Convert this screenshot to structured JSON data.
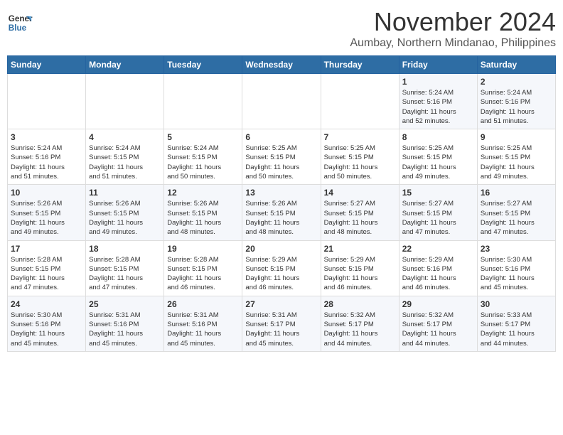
{
  "logo": {
    "line1": "General",
    "line2": "Blue"
  },
  "title": "November 2024",
  "location": "Aumbay, Northern Mindanao, Philippines",
  "weekdays": [
    "Sunday",
    "Monday",
    "Tuesday",
    "Wednesday",
    "Thursday",
    "Friday",
    "Saturday"
  ],
  "weeks": [
    [
      {
        "day": "",
        "info": ""
      },
      {
        "day": "",
        "info": ""
      },
      {
        "day": "",
        "info": ""
      },
      {
        "day": "",
        "info": ""
      },
      {
        "day": "",
        "info": ""
      },
      {
        "day": "1",
        "info": "Sunrise: 5:24 AM\nSunset: 5:16 PM\nDaylight: 11 hours\nand 52 minutes."
      },
      {
        "day": "2",
        "info": "Sunrise: 5:24 AM\nSunset: 5:16 PM\nDaylight: 11 hours\nand 51 minutes."
      }
    ],
    [
      {
        "day": "3",
        "info": "Sunrise: 5:24 AM\nSunset: 5:16 PM\nDaylight: 11 hours\nand 51 minutes."
      },
      {
        "day": "4",
        "info": "Sunrise: 5:24 AM\nSunset: 5:15 PM\nDaylight: 11 hours\nand 51 minutes."
      },
      {
        "day": "5",
        "info": "Sunrise: 5:24 AM\nSunset: 5:15 PM\nDaylight: 11 hours\nand 50 minutes."
      },
      {
        "day": "6",
        "info": "Sunrise: 5:25 AM\nSunset: 5:15 PM\nDaylight: 11 hours\nand 50 minutes."
      },
      {
        "day": "7",
        "info": "Sunrise: 5:25 AM\nSunset: 5:15 PM\nDaylight: 11 hours\nand 50 minutes."
      },
      {
        "day": "8",
        "info": "Sunrise: 5:25 AM\nSunset: 5:15 PM\nDaylight: 11 hours\nand 49 minutes."
      },
      {
        "day": "9",
        "info": "Sunrise: 5:25 AM\nSunset: 5:15 PM\nDaylight: 11 hours\nand 49 minutes."
      }
    ],
    [
      {
        "day": "10",
        "info": "Sunrise: 5:26 AM\nSunset: 5:15 PM\nDaylight: 11 hours\nand 49 minutes."
      },
      {
        "day": "11",
        "info": "Sunrise: 5:26 AM\nSunset: 5:15 PM\nDaylight: 11 hours\nand 49 minutes."
      },
      {
        "day": "12",
        "info": "Sunrise: 5:26 AM\nSunset: 5:15 PM\nDaylight: 11 hours\nand 48 minutes."
      },
      {
        "day": "13",
        "info": "Sunrise: 5:26 AM\nSunset: 5:15 PM\nDaylight: 11 hours\nand 48 minutes."
      },
      {
        "day": "14",
        "info": "Sunrise: 5:27 AM\nSunset: 5:15 PM\nDaylight: 11 hours\nand 48 minutes."
      },
      {
        "day": "15",
        "info": "Sunrise: 5:27 AM\nSunset: 5:15 PM\nDaylight: 11 hours\nand 47 minutes."
      },
      {
        "day": "16",
        "info": "Sunrise: 5:27 AM\nSunset: 5:15 PM\nDaylight: 11 hours\nand 47 minutes."
      }
    ],
    [
      {
        "day": "17",
        "info": "Sunrise: 5:28 AM\nSunset: 5:15 PM\nDaylight: 11 hours\nand 47 minutes."
      },
      {
        "day": "18",
        "info": "Sunrise: 5:28 AM\nSunset: 5:15 PM\nDaylight: 11 hours\nand 47 minutes."
      },
      {
        "day": "19",
        "info": "Sunrise: 5:28 AM\nSunset: 5:15 PM\nDaylight: 11 hours\nand 46 minutes."
      },
      {
        "day": "20",
        "info": "Sunrise: 5:29 AM\nSunset: 5:15 PM\nDaylight: 11 hours\nand 46 minutes."
      },
      {
        "day": "21",
        "info": "Sunrise: 5:29 AM\nSunset: 5:15 PM\nDaylight: 11 hours\nand 46 minutes."
      },
      {
        "day": "22",
        "info": "Sunrise: 5:29 AM\nSunset: 5:16 PM\nDaylight: 11 hours\nand 46 minutes."
      },
      {
        "day": "23",
        "info": "Sunrise: 5:30 AM\nSunset: 5:16 PM\nDaylight: 11 hours\nand 45 minutes."
      }
    ],
    [
      {
        "day": "24",
        "info": "Sunrise: 5:30 AM\nSunset: 5:16 PM\nDaylight: 11 hours\nand 45 minutes."
      },
      {
        "day": "25",
        "info": "Sunrise: 5:31 AM\nSunset: 5:16 PM\nDaylight: 11 hours\nand 45 minutes."
      },
      {
        "day": "26",
        "info": "Sunrise: 5:31 AM\nSunset: 5:16 PM\nDaylight: 11 hours\nand 45 minutes."
      },
      {
        "day": "27",
        "info": "Sunrise: 5:31 AM\nSunset: 5:17 PM\nDaylight: 11 hours\nand 45 minutes."
      },
      {
        "day": "28",
        "info": "Sunrise: 5:32 AM\nSunset: 5:17 PM\nDaylight: 11 hours\nand 44 minutes."
      },
      {
        "day": "29",
        "info": "Sunrise: 5:32 AM\nSunset: 5:17 PM\nDaylight: 11 hours\nand 44 minutes."
      },
      {
        "day": "30",
        "info": "Sunrise: 5:33 AM\nSunset: 5:17 PM\nDaylight: 11 hours\nand 44 minutes."
      }
    ]
  ]
}
